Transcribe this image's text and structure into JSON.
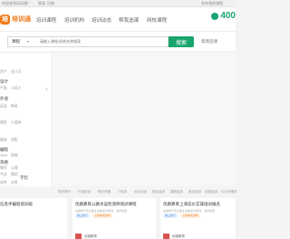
{
  "topbar": {
    "left": "欢迎来到培训通！",
    "links": [
      "登录",
      "注册"
    ],
    "right": "发布我的课程"
  },
  "header": {
    "logo_mark": "培",
    "logo_text": "培训通",
    "nav": [
      "培训课程",
      "培训机构",
      "培训动态",
      "帮我选课",
      "网校课程"
    ],
    "phone": "400"
  },
  "search": {
    "category": "课程",
    "placeholder": "请输入课程/机构名称搜索",
    "button": "搜索",
    "advanced": "帮我选课"
  },
  "sidebar": {
    "categories": [
      {
        "title": "",
        "subs": [
          "资产",
          "会计证"
        ]
      },
      {
        "title": "设计",
        "subs": [
          "平面",
          "UI设计"
        ]
      },
      {
        "title": "外语",
        "subs": [
          "英语",
          "韩语"
        ]
      },
      {
        "title": "",
        "subs": [
          "雅思",
          "小语种"
        ]
      },
      {
        "title": "",
        "subs": [
          "建造",
          "消防"
        ]
      },
      {
        "title": "编程",
        "subs": [
          "Java",
          "前端"
        ]
      },
      {
        "title": "资格",
        "subs": [
          "教师",
          "心理"
        ]
      },
      {
        "title": "",
        "subs": [
          "书法",
          "舞蹈"
        ]
      },
      {
        "title": "学历",
        "subs": [
          "成考",
          "自考"
        ]
      }
    ]
  },
  "links": [
    "学历提升",
    "外语培训",
    "职业资格",
    "IT培训",
    "设计培训",
    "财会培训",
    "建筑培训",
    "语言培训",
    "技能培训",
    "中小学辅导",
    "留学服务"
  ],
  "cards": [
    {
      "title": "信息手编程培训班",
      "desc": "专业编程老师授课",
      "badges": [
        "小班授课",
        "入学免费试听"
      ],
      "thumb_label": "编程课"
    },
    {
      "title": "优路教育公路水运检测师培训课程",
      "desc": "优路教育专注职业资格考试培训，名师授课",
      "badges": [
        "线上线下",
        "入学免费试听"
      ],
      "thumb_label": "优路教育"
    },
    {
      "title": "优路教育上海造价实操培训报名",
      "desc": "优路教育专注职业资格考试培训，名师授课",
      "badges": [
        "线上线下",
        "入学免费试听"
      ],
      "thumb_label": "优路教育"
    }
  ],
  "colors": {
    "brand_orange": "#f07a1b",
    "brand_green": "#18a56d"
  }
}
